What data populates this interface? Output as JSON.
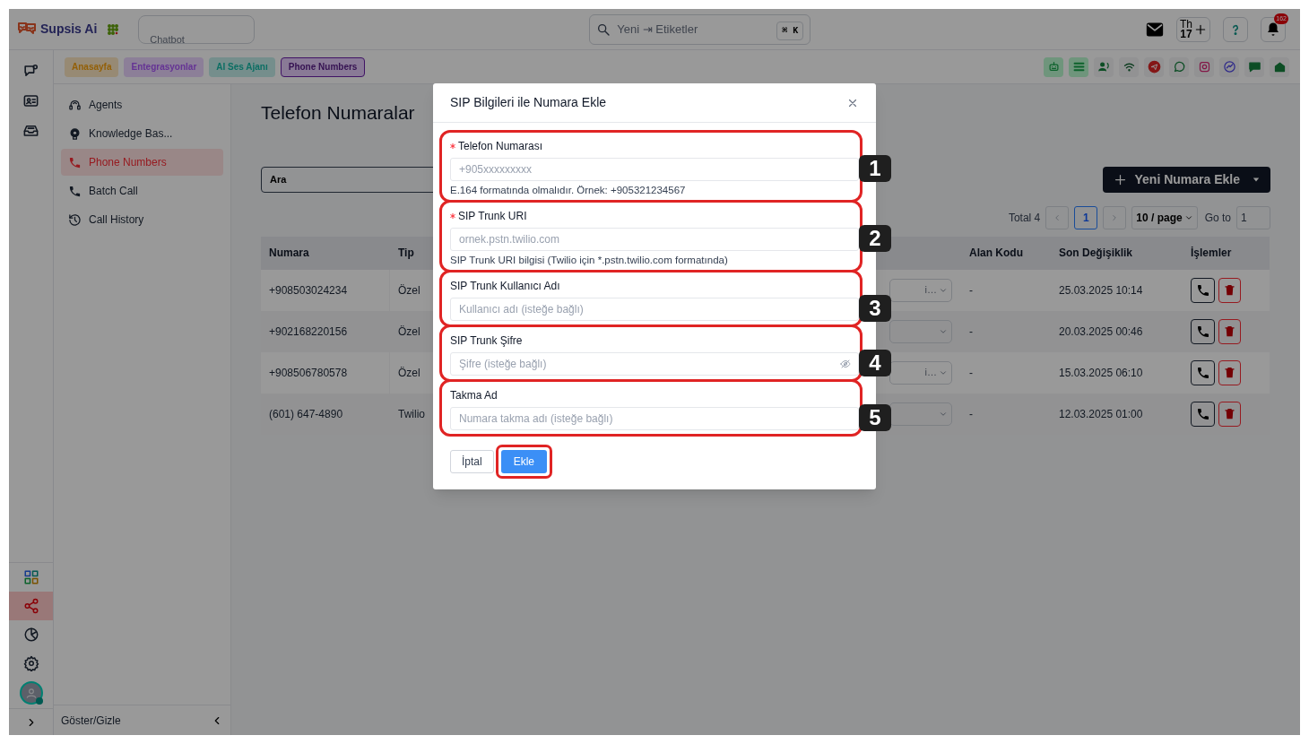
{
  "topbar": {
    "brand": "Supsis Ai",
    "workspace": "Chatbot",
    "search": {
      "placeholder": "Yeni ⇥ Etiketler",
      "shortcut": "⌘ K"
    },
    "calendar": {
      "day": "Th",
      "date": "17"
    },
    "notifications": "162"
  },
  "tabs": [
    {
      "label": "Anasayfa",
      "selected": false
    },
    {
      "label": "Entegrasyonlar",
      "selected": false
    },
    {
      "label": "AI Ses Ajanı",
      "selected": false
    },
    {
      "label": "Phone Numbers",
      "selected": true
    }
  ],
  "rail": {
    "bottom": [
      {
        "kind": "grid",
        "selected": false
      },
      {
        "kind": "share",
        "selected": true
      },
      {
        "kind": "chart",
        "selected": false
      },
      {
        "kind": "gear",
        "selected": false
      }
    ]
  },
  "sidebar": {
    "items": [
      {
        "label": "Agents",
        "selected": false
      },
      {
        "label": "Knowledge Bas...",
        "selected": false
      },
      {
        "label": "Phone Numbers",
        "selected": true
      },
      {
        "label": "Batch Call",
        "selected": false
      },
      {
        "label": "Call History",
        "selected": false
      }
    ],
    "footer": "Göster/Gizle"
  },
  "main": {
    "title": "Telefon Numaralar",
    "search": {
      "value": "Ara"
    },
    "add_button": "Yeni Numara Ekle",
    "pagination": {
      "total": "Total 4",
      "pages": [
        {
          "label": "1",
          "selected": true
        }
      ],
      "page_size": "10 / page",
      "goto_label": "Go to",
      "goto_value": "1"
    },
    "table": {
      "columns": [
        "Numara",
        "Tip",
        "Alan Kodu",
        "Son Değişiklik",
        "İşlemler"
      ],
      "rows": [
        {
          "numara": "+908503024234",
          "tip": "Özel",
          "column_3": "i…",
          "alan_kodu": "-",
          "son_degisiklik": "25.03.2025 10:14"
        },
        {
          "numara": "+902168220156",
          "tip": "Özel",
          "alan_kodu": "-",
          "son_degisiklik": "20.03.2025 00:46"
        },
        {
          "numara": "+908506780578",
          "tip": "Özel",
          "column_3": "i…",
          "alan_kodu": "-",
          "son_degisiklik": "15.03.2025 06:10"
        },
        {
          "numara": "(601) 647-4890",
          "tip": "Twilio",
          "alan_kodu": "-",
          "son_degisiklik": "12.03.2025 01:00"
        }
      ]
    }
  },
  "modal": {
    "title": "SIP Bilgileri ile Numara Ekle",
    "fields": [
      {
        "label": "Telefon Numarası",
        "required": true,
        "placeholder": "+905xxxxxxxxx",
        "help": "E.164 formatında olmalıdır. Örnek: +905321234567",
        "kind": "text",
        "marker": "1"
      },
      {
        "label": "SIP Trunk URI",
        "required": true,
        "placeholder": "ornek.pstn.twilio.com",
        "help": "SIP Trunk URI bilgisi (Twilio için *.pstn.twilio.com formatında)",
        "kind": "text",
        "marker": "2"
      },
      {
        "label": "SIP Trunk Kullanıcı Adı",
        "required": false,
        "placeholder": "Kullanıcı adı (isteğe bağlı)",
        "kind": "text",
        "marker": "3"
      },
      {
        "label": "SIP Trunk Şifre",
        "required": false,
        "placeholder": "Şifre (isteğe bağlı)",
        "kind": "password",
        "marker": "4"
      },
      {
        "label": "Takma Ad",
        "required": false,
        "placeholder": "Numara takma adı (isteğe bağlı)",
        "kind": "text",
        "marker": "5"
      }
    ],
    "cancel": "İptal",
    "submit": {
      "label": "Ekle",
      "highlighted": true
    }
  }
}
